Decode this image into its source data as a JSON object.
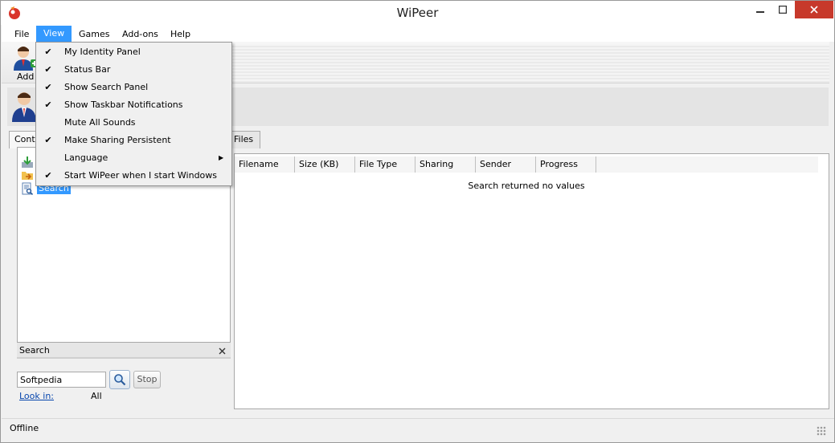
{
  "window": {
    "title": "WiPeer"
  },
  "menubar": {
    "items": [
      {
        "label": "File"
      },
      {
        "label": "View"
      },
      {
        "label": "Games"
      },
      {
        "label": "Add-ons"
      },
      {
        "label": "Help"
      }
    ]
  },
  "view_menu": {
    "items": [
      {
        "label": "My Identity Panel",
        "checked": true
      },
      {
        "label": "Status Bar",
        "checked": true
      },
      {
        "label": "Show Search Panel",
        "checked": true
      },
      {
        "label": "Show Taskbar Notifications",
        "checked": true
      },
      {
        "label": "Mute All Sounds",
        "checked": false
      },
      {
        "label": "Make Sharing Persistent",
        "checked": true
      },
      {
        "label": "Language",
        "checked": false,
        "submenu": true
      },
      {
        "label": "Start WiPeer when I start Windows",
        "checked": true
      }
    ],
    "check_glyph": "✔",
    "arrow_glyph": "▶"
  },
  "toolbar": {
    "add_label": "Add"
  },
  "tabs": {
    "contacts": "Conta",
    "files": "Files"
  },
  "tree": {
    "search_label": "Search"
  },
  "search_panel": {
    "title": "Search",
    "query": "Softpedia",
    "stop_label": "Stop",
    "look_in_label": "Look in:",
    "look_in_value": "All"
  },
  "files_table": {
    "columns": [
      "Filename",
      "Size (KB)",
      "File Type",
      "Sharing",
      "Sender",
      "Progress"
    ],
    "empty_message": "Search returned no values"
  },
  "statusbar": {
    "text": "Offline"
  },
  "colors": {
    "selection": "#3399ff",
    "close_button": "#c7392b"
  }
}
